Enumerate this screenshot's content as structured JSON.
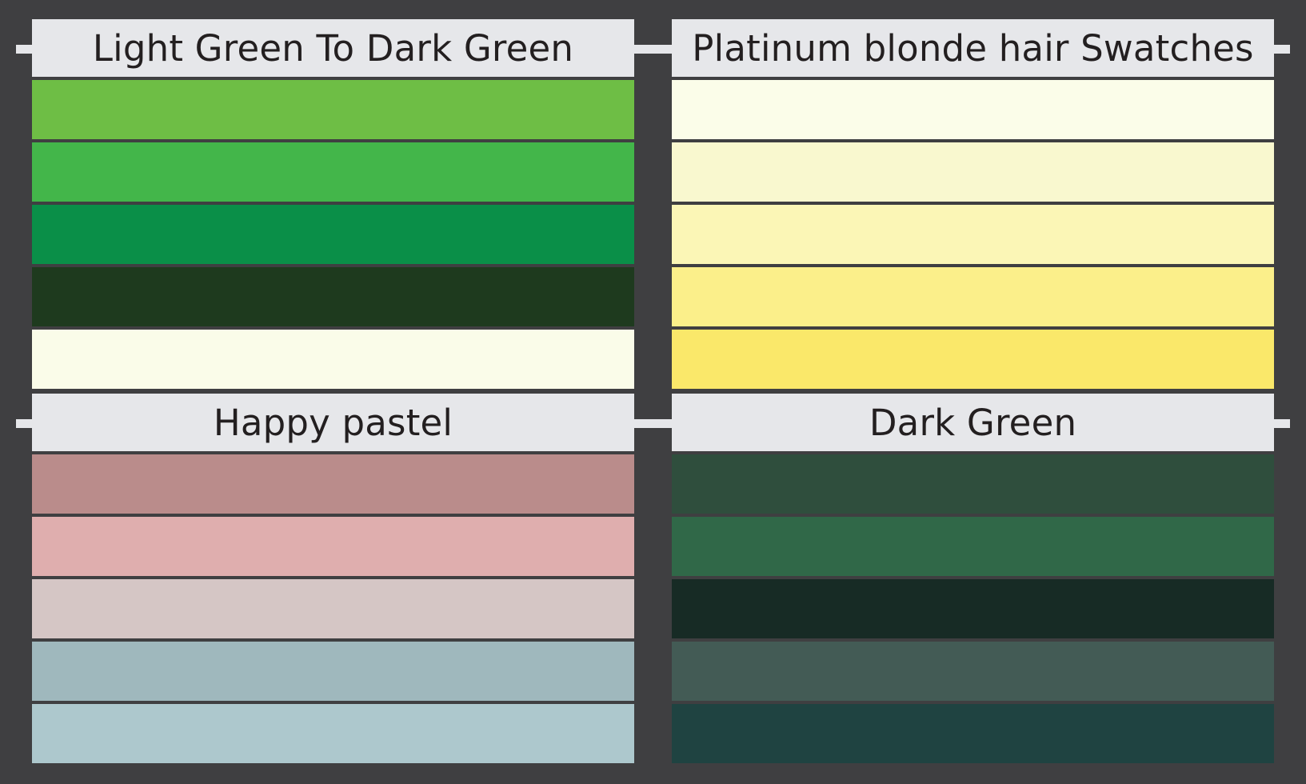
{
  "panels": [
    {
      "title": "Light Green To Dark Green",
      "colors": [
        "#6ebe45",
        "#43b64a",
        "#0a8f48",
        "#1e3a1e",
        "#fafce9"
      ]
    },
    {
      "title": "Platinum blonde hair Swatches",
      "colors": [
        "#fbfde9",
        "#f9f8cf",
        "#fbf6b6",
        "#fbef8a",
        "#fae86a"
      ]
    },
    {
      "title": "Happy pastel",
      "colors": [
        "#ba8c8b",
        "#dfaeae",
        "#d5c6c5",
        "#9fb8bd",
        "#adc8cd"
      ]
    },
    {
      "title": "Dark Green",
      "colors": [
        "#2f4e3d",
        "#306848",
        "#172b25",
        "#435b55",
        "#1f4341"
      ]
    }
  ],
  "theme": {
    "background": "#3f3f41",
    "title_bar": "#e6e7ea",
    "title_text": "#231f20"
  }
}
